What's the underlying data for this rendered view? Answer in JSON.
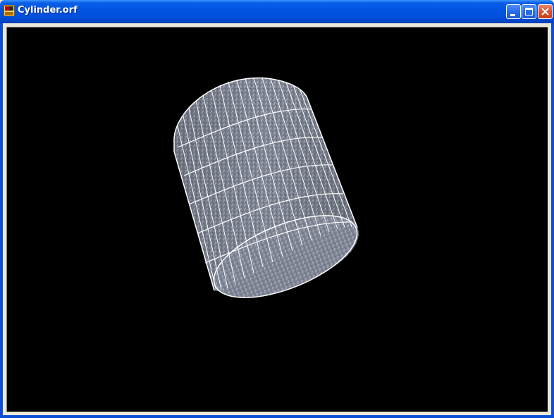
{
  "window": {
    "title": "Cylinder.orf",
    "buttons": {
      "minimize": "minimize-icon",
      "maximize": "maximize-icon",
      "close": "close-icon"
    }
  },
  "viewport": {
    "background": "#000000",
    "object": "cylinder",
    "wireframe_color": "#ffffff",
    "surface_color": "#8a8f9e"
  }
}
